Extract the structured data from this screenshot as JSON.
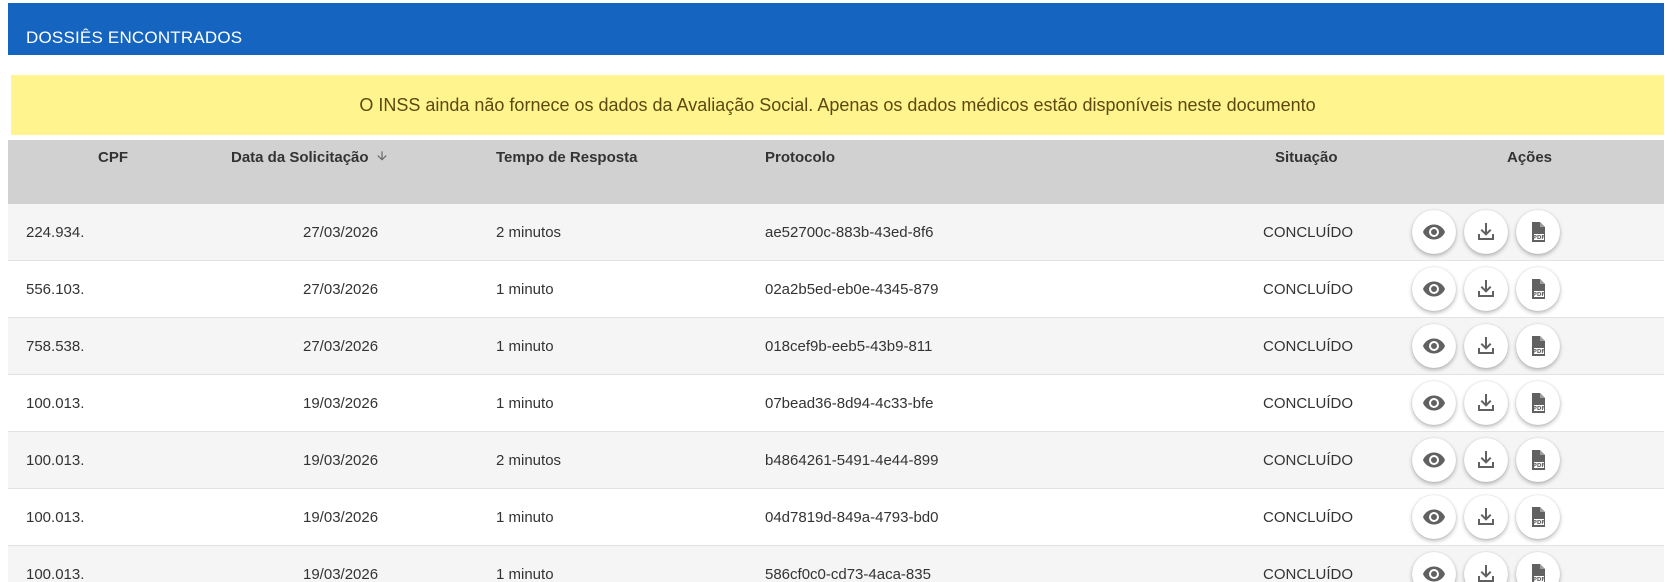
{
  "panel": {
    "title": "DOSSIÊS ENCONTRADOS"
  },
  "notice": {
    "text": "O INSS ainda não fornece os dados da Avaliação Social. Apenas os dados médicos estão disponíveis neste documento"
  },
  "table": {
    "headers": {
      "cpf": "CPF",
      "data": "Data da Solicitação",
      "tempo": "Tempo de Resposta",
      "protocolo": "Protocolo",
      "situacao": "Situação",
      "acoes": "Ações"
    },
    "sort_icon": "arrow-down-icon",
    "action_icons": [
      "eye-icon",
      "download-icon",
      "pdf-icon"
    ],
    "rows": [
      {
        "cpf": "224.934.",
        "data": "27/03/2026",
        "tempo": "2 minutos",
        "protocolo": "ae52700c-883b-43ed-8f6",
        "situacao": "CONCLUÍDO"
      },
      {
        "cpf": "556.103.",
        "data": "27/03/2026",
        "tempo": "1 minuto",
        "protocolo": "02a2b5ed-eb0e-4345-879",
        "situacao": "CONCLUÍDO"
      },
      {
        "cpf": "758.538.",
        "data": "27/03/2026",
        "tempo": "1 minuto",
        "protocolo": "018cef9b-eeb5-43b9-811",
        "situacao": "CONCLUÍDO"
      },
      {
        "cpf": "100.013.",
        "data": "19/03/2026",
        "tempo": "1 minuto",
        "protocolo": "07bead36-8d94-4c33-bfe",
        "situacao": "CONCLUÍDO"
      },
      {
        "cpf": "100.013.",
        "data": "19/03/2026",
        "tempo": "2 minutos",
        "protocolo": "b4864261-5491-4e44-899",
        "situacao": "CONCLUÍDO"
      },
      {
        "cpf": "100.013.",
        "data": "19/03/2026",
        "tempo": "1 minuto",
        "protocolo": "04d7819d-849a-4793-bd0",
        "situacao": "CONCLUÍDO"
      },
      {
        "cpf": "100.013.",
        "data": "19/03/2026",
        "tempo": "1 minuto",
        "protocolo": "586cf0c0-cd73-4aca-835",
        "situacao": "CONCLUÍDO"
      }
    ]
  },
  "colors": {
    "header_bg": "#1565c0",
    "notice_bg": "#fff48d",
    "table_head_bg": "#d1d1d1"
  }
}
